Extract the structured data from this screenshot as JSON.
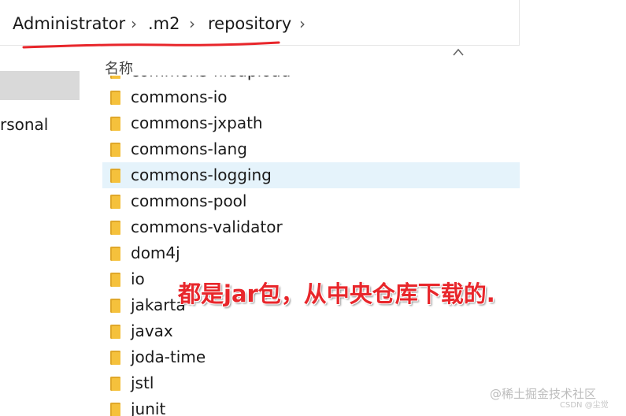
{
  "breadcrumb": {
    "items": [
      "Administrator",
      ".m2",
      "repository"
    ],
    "separator": "›"
  },
  "nav": {
    "partial_item": "rsonal"
  },
  "list": {
    "column_header": "名称",
    "sort_icon": "chevron-up-icon",
    "rows": [
      {
        "name": "commons-fileupload",
        "highlighted": false
      },
      {
        "name": "commons-io",
        "highlighted": false
      },
      {
        "name": "commons-jxpath",
        "highlighted": false
      },
      {
        "name": "commons-lang",
        "highlighted": false
      },
      {
        "name": "commons-logging",
        "highlighted": true
      },
      {
        "name": "commons-pool",
        "highlighted": false
      },
      {
        "name": "commons-validator",
        "highlighted": false
      },
      {
        "name": "dom4j",
        "highlighted": false
      },
      {
        "name": "io",
        "highlighted": false
      },
      {
        "name": "jakarta",
        "highlighted": false
      },
      {
        "name": "javax",
        "highlighted": false
      },
      {
        "name": "joda-time",
        "highlighted": false
      },
      {
        "name": "jstl",
        "highlighted": false
      },
      {
        "name": "junit",
        "highlighted": false
      }
    ]
  },
  "annotation": {
    "text": "都是jar包，从中央仓库下载的.",
    "color": "#e8262b"
  },
  "watermark": {
    "line1": "@稀土掘金技术社区",
    "line2": "CSDN @尘觉"
  },
  "colors": {
    "folder": "#f5c13c",
    "folder_dark": "#e0a82a",
    "highlight": "#e5f3fb",
    "nav_selected": "#d9d9d9"
  }
}
